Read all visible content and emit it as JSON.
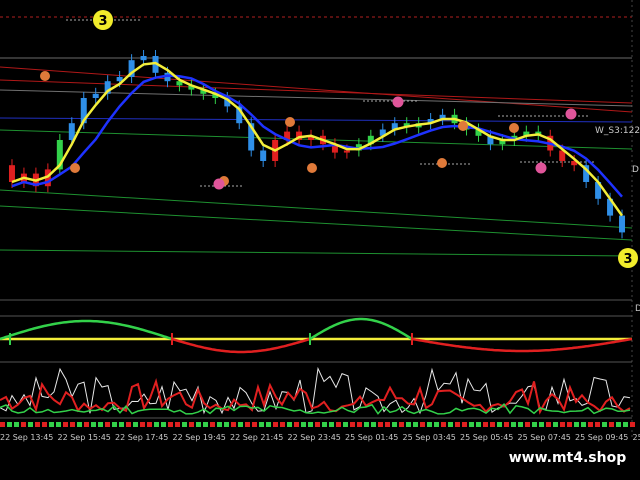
{
  "watermark": "www.mt4.shop",
  "level_labels": {
    "w_s3": "W_S3:122",
    "right_edge_top": "D",
    "right_edge_bottom": "D"
  },
  "markers": {
    "wave_top": "3",
    "wave_bottom": "3"
  },
  "time_axis": {
    "labels": [
      "22 Sep 13:45",
      "22 Sep 15:45",
      "22 Sep 17:45",
      "22 Sep 19:45",
      "22 Sep 21:45",
      "22 Sep 23:45",
      "25 Sep 01:45",
      "25 Sep 03:45",
      "25 Sep 05:45",
      "25 Sep 07:45",
      "25 Sep 09:45",
      "25"
    ]
  },
  "colors": {
    "background": "#000000",
    "candle_up": "#2f8fe8",
    "candle_green": "#33d14a",
    "candle_red": "#e02020",
    "ma_yellow": "#f3ee3a",
    "ma_blue": "#1e32ff",
    "osc_green": "#33d14a",
    "osc_red": "#e02020",
    "osc_white": "#e8e8e8"
  },
  "chart_data": {
    "type": "candlestick",
    "title": "",
    "price_series": [
      {
        "o": 0.62,
        "c": 0.7,
        "t": "r"
      },
      {
        "o": 0.7,
        "c": 0.66,
        "t": "r"
      },
      {
        "o": 0.66,
        "c": 0.72,
        "t": "r"
      },
      {
        "o": 0.72,
        "c": 0.64,
        "t": "r"
      },
      {
        "o": 0.64,
        "c": 0.5,
        "t": "g"
      },
      {
        "o": 0.5,
        "c": 0.42,
        "t": "b"
      },
      {
        "o": 0.42,
        "c": 0.3,
        "t": "b"
      },
      {
        "o": 0.3,
        "c": 0.28,
        "t": "b"
      },
      {
        "o": 0.28,
        "c": 0.22,
        "t": "b"
      },
      {
        "o": 0.22,
        "c": 0.2,
        "t": "b"
      },
      {
        "o": 0.2,
        "c": 0.12,
        "t": "b"
      },
      {
        "o": 0.12,
        "c": 0.1,
        "t": "b"
      },
      {
        "o": 0.1,
        "c": 0.18,
        "t": "b"
      },
      {
        "o": 0.18,
        "c": 0.22,
        "t": "b"
      },
      {
        "o": 0.22,
        "c": 0.24,
        "t": "g"
      },
      {
        "o": 0.24,
        "c": 0.26,
        "t": "g"
      },
      {
        "o": 0.26,
        "c": 0.28,
        "t": "g"
      },
      {
        "o": 0.28,
        "c": 0.3,
        "t": "g"
      },
      {
        "o": 0.3,
        "c": 0.34,
        "t": "b"
      },
      {
        "o": 0.34,
        "c": 0.42,
        "t": "b"
      },
      {
        "o": 0.42,
        "c": 0.55,
        "t": "b"
      },
      {
        "o": 0.55,
        "c": 0.6,
        "t": "b"
      },
      {
        "o": 0.6,
        "c": 0.5,
        "t": "r"
      },
      {
        "o": 0.5,
        "c": 0.46,
        "t": "r"
      },
      {
        "o": 0.46,
        "c": 0.5,
        "t": "r"
      },
      {
        "o": 0.5,
        "c": 0.48,
        "t": "r"
      },
      {
        "o": 0.48,
        "c": 0.52,
        "t": "r"
      },
      {
        "o": 0.52,
        "c": 0.56,
        "t": "r"
      },
      {
        "o": 0.56,
        "c": 0.55,
        "t": "r"
      },
      {
        "o": 0.55,
        "c": 0.52,
        "t": "g"
      },
      {
        "o": 0.52,
        "c": 0.48,
        "t": "g"
      },
      {
        "o": 0.48,
        "c": 0.45,
        "t": "b"
      },
      {
        "o": 0.45,
        "c": 0.42,
        "t": "b"
      },
      {
        "o": 0.42,
        "c": 0.44,
        "t": "g"
      },
      {
        "o": 0.44,
        "c": 0.42,
        "t": "g"
      },
      {
        "o": 0.42,
        "c": 0.4,
        "t": "b"
      },
      {
        "o": 0.4,
        "c": 0.38,
        "t": "b"
      },
      {
        "o": 0.38,
        "c": 0.42,
        "t": "g"
      },
      {
        "o": 0.42,
        "c": 0.45,
        "t": "g"
      },
      {
        "o": 0.45,
        "c": 0.48,
        "t": "g"
      },
      {
        "o": 0.48,
        "c": 0.52,
        "t": "b"
      },
      {
        "o": 0.52,
        "c": 0.5,
        "t": "g"
      },
      {
        "o": 0.5,
        "c": 0.48,
        "t": "g"
      },
      {
        "o": 0.48,
        "c": 0.46,
        "t": "g"
      },
      {
        "o": 0.46,
        "c": 0.48,
        "t": "g"
      },
      {
        "o": 0.48,
        "c": 0.55,
        "t": "r"
      },
      {
        "o": 0.55,
        "c": 0.6,
        "t": "r"
      },
      {
        "o": 0.6,
        "c": 0.62,
        "t": "r"
      },
      {
        "o": 0.62,
        "c": 0.7,
        "t": "b"
      },
      {
        "o": 0.7,
        "c": 0.78,
        "t": "b"
      },
      {
        "o": 0.78,
        "c": 0.86,
        "t": "b"
      },
      {
        "o": 0.86,
        "c": 0.94,
        "t": "b"
      }
    ],
    "oscillator_1": {
      "zero_line": 0.5,
      "segments": [
        "green",
        "red",
        "green",
        "red"
      ]
    },
    "oscillator_2": {
      "series": [
        {
          "name": "",
          "color": "white"
        },
        {
          "name": "",
          "color": "red"
        },
        {
          "name": "",
          "color": "green"
        }
      ]
    }
  }
}
